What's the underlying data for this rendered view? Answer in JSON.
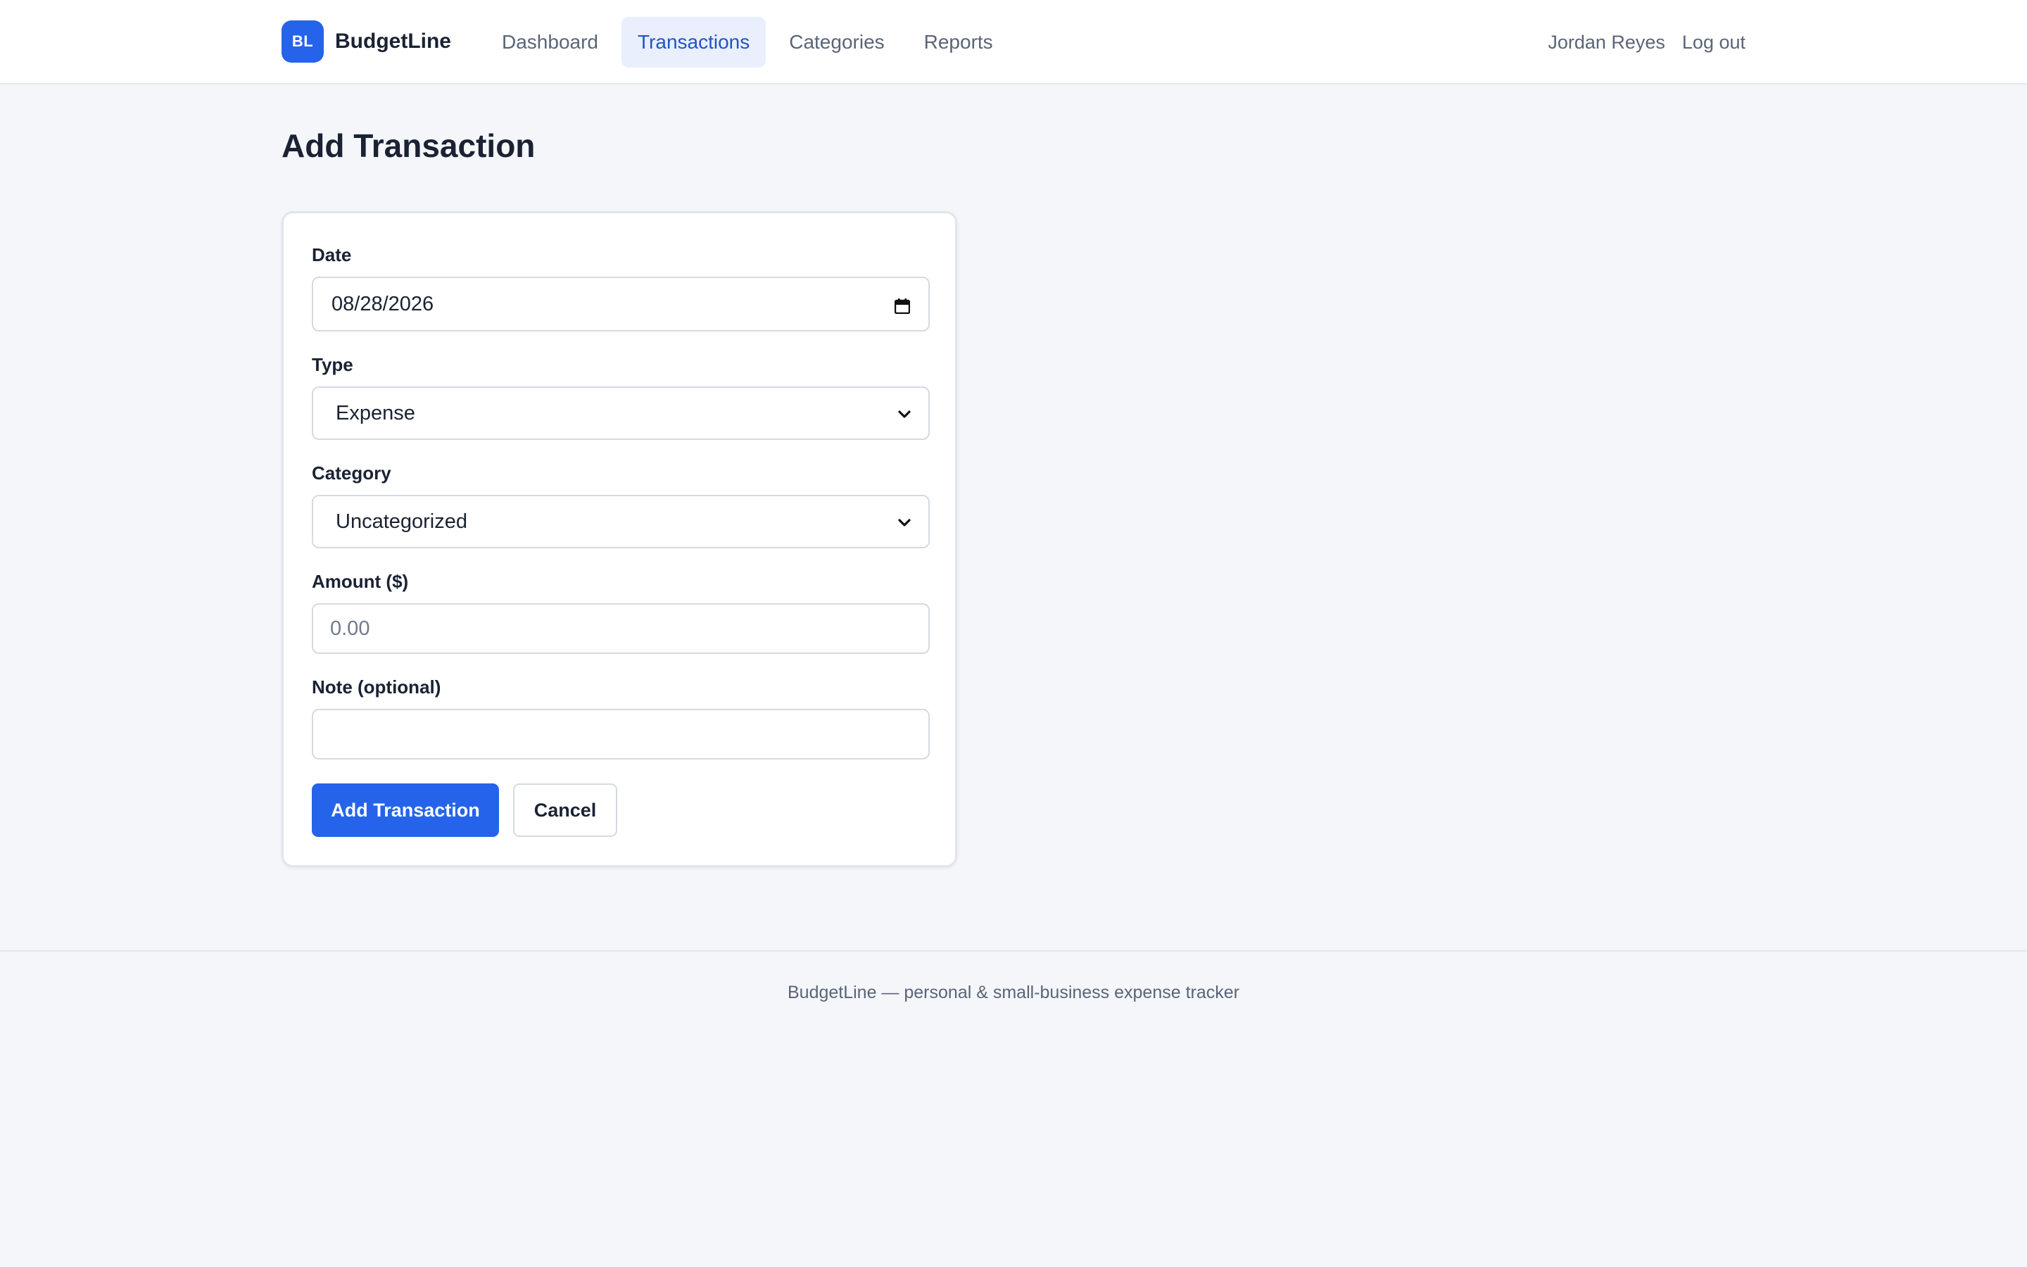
{
  "brand": {
    "logo_text": "BL",
    "name": "BudgetLine",
    "accent_color": "#2563eb"
  },
  "nav": {
    "items": [
      {
        "label": "Dashboard",
        "active": false
      },
      {
        "label": "Transactions",
        "active": true
      },
      {
        "label": "Categories",
        "active": false
      },
      {
        "label": "Reports",
        "active": false
      }
    ]
  },
  "user": {
    "name": "Jordan Reyes",
    "logout_label": "Log out"
  },
  "page": {
    "title": "Add Transaction"
  },
  "form": {
    "date": {
      "label": "Date",
      "value": "08/28/2026",
      "icon": "calendar-icon"
    },
    "type": {
      "label": "Type",
      "selected": "Expense",
      "icon": "chevron-down-icon"
    },
    "category": {
      "label": "Category",
      "selected": "Uncategorized",
      "icon": "chevron-down-icon"
    },
    "amount": {
      "label": "Amount ($)",
      "value": "",
      "placeholder": "0.00"
    },
    "note": {
      "label": "Note (optional)",
      "value": "",
      "placeholder": ""
    },
    "submit_label": "Add Transaction",
    "cancel_label": "Cancel"
  },
  "footer": {
    "text": "BudgetLine — personal & small-business expense tracker"
  }
}
